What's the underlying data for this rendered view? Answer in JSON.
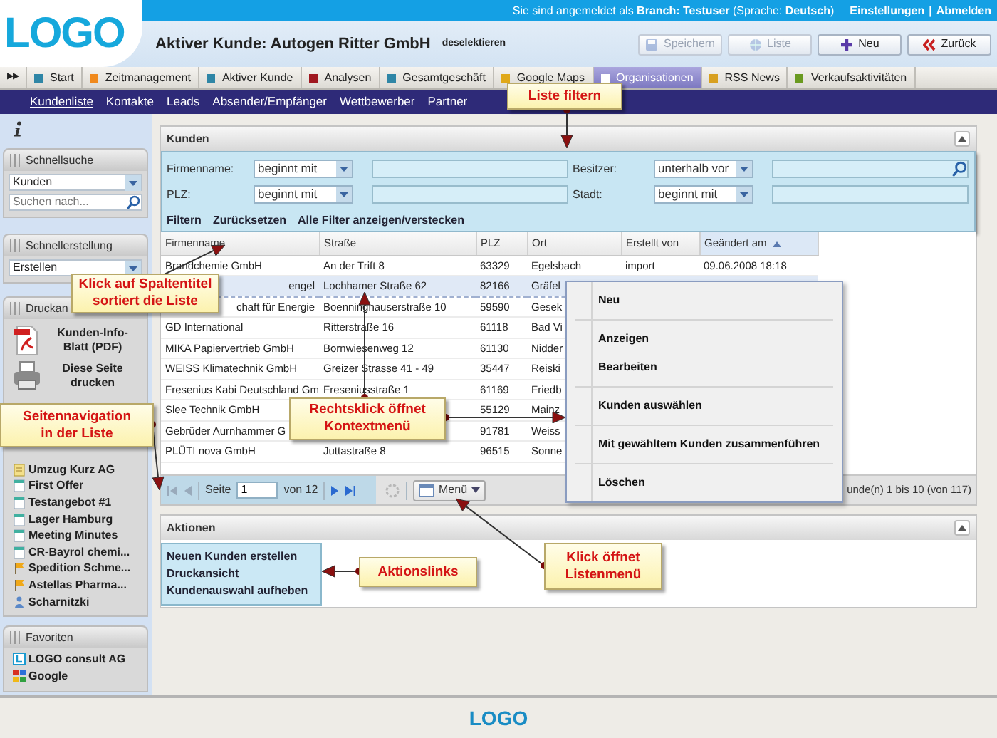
{
  "header": {
    "logo": "LOGO",
    "login_text": "Sie sind angemeldet als **Branch: Testuser** (Sprache: **Deutsch**)",
    "links": [
      "Einstellungen",
      "Abmelden"
    ],
    "link_separator": "|",
    "title": "Aktiver Kunde: Autogen Ritter GmbH",
    "deselect_link": "deselektieren",
    "buttons": [
      {
        "kind": "save",
        "label": "Speichern",
        "disabled": true
      },
      {
        "kind": "list",
        "label": "Liste",
        "disabled": true
      },
      {
        "kind": "new",
        "label": "Neu",
        "disabled": false
      },
      {
        "kind": "back",
        "label": "Zurück",
        "disabled": false
      }
    ]
  },
  "tabs": {
    "expander": "▶▶",
    "items": [
      {
        "label": "Start",
        "color": "#2f86a6",
        "selected": false
      },
      {
        "label": "Zeitmanagement",
        "color": "#f0891c",
        "selected": false
      },
      {
        "label": "Aktiver Kunde",
        "color": "#2f86a6",
        "selected": false
      },
      {
        "label": "Analysen",
        "color": "#a01820",
        "selected": false
      },
      {
        "label": "Gesamtgeschäft",
        "color": "#2f86a6",
        "selected": false
      },
      {
        "label": "Google Maps",
        "color": "#e0a818",
        "selected": false
      },
      {
        "label": "Organisationen",
        "color": "#ffffff",
        "selected": true
      },
      {
        "label": "RSS News",
        "color": "#d8a020",
        "selected": false
      },
      {
        "label": "Verkaufsaktivitäten",
        "color": "#6a9a20",
        "selected": false
      }
    ]
  },
  "subnav": [
    {
      "label": "Kundenliste",
      "selected": true
    },
    {
      "label": "Kontakte",
      "selected": false
    },
    {
      "label": "Leads",
      "selected": false
    },
    {
      "label": "Absender/Empfänger",
      "selected": false
    },
    {
      "label": "Wettbewerber",
      "selected": false
    },
    {
      "label": "Partner",
      "selected": false
    }
  ],
  "sidebar": {
    "quick_search": {
      "title": "Schnellsuche",
      "select": "Kunden",
      "placeholder": "Suchen nach..."
    },
    "quick_create": {
      "title": "Schnellerstellung",
      "select": "Erstellen"
    },
    "print": {
      "title": "Druckan",
      "items": [
        {
          "kind": "pdf",
          "label": "Kunden-Info-Blatt (PDF)"
        },
        {
          "kind": "printer",
          "label": "Diese Seite drucken"
        }
      ]
    },
    "recent": [
      {
        "kind": "note",
        "label": "Umzug Kurz AG"
      },
      {
        "kind": "document",
        "label": "First Offer"
      },
      {
        "kind": "document",
        "label": "Testangebot #1"
      },
      {
        "kind": "document",
        "label": "Lager Hamburg"
      },
      {
        "kind": "document",
        "label": "Meeting Minutes"
      },
      {
        "kind": "document",
        "label": "CR-Bayrol chemi..."
      },
      {
        "kind": "flag",
        "label": "Spedition Schme..."
      },
      {
        "kind": "flag",
        "label": "Astellas Pharma..."
      },
      {
        "kind": "person",
        "label": "Scharnitzki"
      }
    ],
    "favorites": {
      "title": "Favoriten",
      "items": [
        {
          "kind": "logo",
          "label": "LOGO consult AG"
        },
        {
          "kind": "google",
          "label": "Google"
        }
      ]
    }
  },
  "customers": {
    "title": "Kunden",
    "filters": [
      {
        "label": "Firmenname:",
        "operator": "beginnt mit",
        "search": false
      },
      {
        "label": "Besitzer:",
        "operator": "unterhalb vor",
        "search": true
      },
      {
        "label": "PLZ:",
        "operator": "beginnt mit",
        "search": false
      },
      {
        "label": "Stadt:",
        "operator": "beginnt mit",
        "search": false
      }
    ],
    "filter_links": [
      "Filtern",
      "Zurücksetzen",
      "Alle Filter anzeigen/verstecken"
    ],
    "table": {
      "columns": [
        {
          "label": "Firmenname",
          "sorted": false
        },
        {
          "label": "Straße",
          "sorted": false
        },
        {
          "label": "PLZ",
          "sorted": false
        },
        {
          "label": "Ort",
          "sorted": false
        },
        {
          "label": "Erstellt von",
          "sorted": false
        },
        {
          "label": "Geändert am",
          "sorted": true
        }
      ],
      "rows": [
        {
          "selected": false,
          "cells": [
            "Brandchemie GmbH",
            "An der Trift 8",
            "63329",
            "Egelsbach",
            "import",
            "09.06.2008 18:18"
          ]
        },
        {
          "selected": true,
          "lead_cut": true,
          "cells": [
            "engel",
            "Lochhamer Straße 62",
            "82166",
            "Gräfel",
            null,
            null
          ]
        },
        {
          "selected": false,
          "lead_cut": true,
          "cells": [
            "chaft für Energie",
            "Boenninghauserstraße 10",
            "59590",
            "Gesek",
            null,
            null
          ]
        },
        {
          "selected": false,
          "cells": [
            "GD International",
            "Ritterstraße 16",
            "61118",
            "Bad Vi",
            null,
            null
          ]
        },
        {
          "selected": false,
          "cells": [
            "MIKA Papiervertrieb GmbH",
            "Bornwiesenweg 12",
            "61130",
            "Nidder",
            null,
            null
          ]
        },
        {
          "selected": false,
          "cells": [
            "WEISS Klimatechnik GmbH",
            "Greizer Strasse 41 - 49",
            "35447",
            "Reiski",
            null,
            null
          ]
        },
        {
          "selected": false,
          "cells": [
            "Fresenius Kabi Deutschland Gm",
            "Freseniusstraße 1",
            "61169",
            "Friedb",
            null,
            null
          ]
        },
        {
          "selected": false,
          "cells": [
            "Slee Technik GmbH",
            null,
            "55129",
            "Mainz",
            null,
            null
          ]
        },
        {
          "selected": false,
          "cells": [
            "Gebrüder Aurnhammer G",
            null,
            "91781",
            "Weiss",
            null,
            null
          ]
        },
        {
          "selected": false,
          "cells": [
            "PLÜTI nova GmbH",
            "Juttastraße 8",
            "96515",
            "Sonne",
            null,
            null
          ]
        }
      ]
    },
    "pager": {
      "page_label": "Seite",
      "page": "1",
      "total": "von 12",
      "menu": "Menü",
      "summary": "unde(n) 1 bis 10 (von 117)"
    }
  },
  "actions": {
    "title": "Aktionen",
    "links": [
      "Neuen Kunden erstellen",
      "Druckansicht",
      "Kundenauswahl aufheben"
    ]
  },
  "context_menu": {
    "groups": [
      [
        "Neu"
      ],
      [
        "Anzeigen",
        "Bearbeiten"
      ],
      [
        "Kunden auswählen"
      ],
      [
        "Mit gewähltem Kunden zusammenführen"
      ],
      [
        "Löschen"
      ]
    ]
  },
  "callouts": [
    "Liste filtern",
    "Klick auf Spaltentitel\nsortiert die Liste",
    "Rechtsklick öffnet\nKontextmenü",
    "Seitennavigation\nin der Liste",
    "Aktionslinks",
    "Klick öffnet\nListenmenü"
  ],
  "footer": {
    "logo": "LOGO"
  }
}
